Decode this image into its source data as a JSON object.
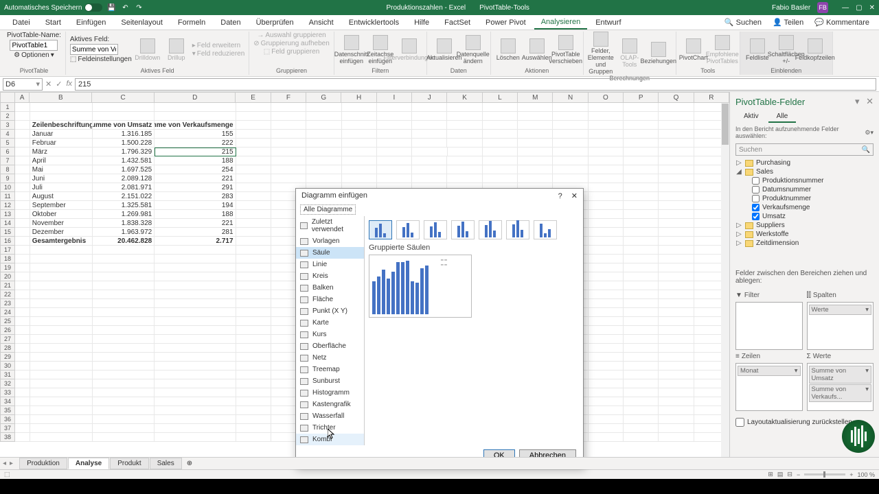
{
  "titlebar": {
    "autosave": "Automatisches Speichern",
    "doc": "Produktionszahlen",
    "app": "Excel",
    "tooltab": "PivotTable-Tools",
    "user": "Fabio Basler",
    "initials": "FB"
  },
  "tabs": [
    "Datei",
    "Start",
    "Einfügen",
    "Seitenlayout",
    "Formeln",
    "Daten",
    "Überprüfen",
    "Ansicht",
    "Entwicklertools",
    "Hilfe",
    "FactSet",
    "Power Pivot",
    "Analysieren",
    "Entwurf"
  ],
  "tab_active": "Analysieren",
  "tab_search": "Suchen",
  "tab_share": "Teilen",
  "tab_comments": "Kommentare",
  "ribbon": {
    "pivot_name_lbl": "PivotTable-Name:",
    "pivot_name": "PivotTable1",
    "options_btn": "Optionen",
    "group_pivot": "PivotTable",
    "active_field_lbl": "Aktives Feld:",
    "active_field": "Summe von Verk",
    "field_settings": "Feldeinstellungen",
    "drilldown": "Drilldown",
    "drillup": "Drillup",
    "expand_field": "Feld erweitern",
    "reduce_field": "Feld reduzieren",
    "group_active": "Aktives Feld",
    "sel_group": "Auswahl gruppieren",
    "ungroup": "Gruppierung aufheben",
    "group_field": "Feld gruppieren",
    "group_group": "Gruppieren",
    "slicer": "Datenschnitt einfügen",
    "timeline": "Zeitachse einfügen",
    "filter_conn": "Filterverbindungen",
    "group_filter": "Filtern",
    "refresh": "Aktualisieren",
    "change_src": "Datenquelle ändern",
    "group_data": "Daten",
    "delete": "Löschen",
    "select": "Auswählen",
    "move": "PivotTable verschieben",
    "group_actions": "Aktionen",
    "fields_items": "Felder, Elemente und Gruppen",
    "olap": "OLAP-Tools",
    "relations": "Beziehungen",
    "group_calc": "Berechnungen",
    "pivotchart": "PivotChart",
    "recommended": "Empfohlene PivotTables",
    "group_tools": "Tools",
    "fieldlist": "Feldliste",
    "buttons_pm": "Schaltflächen +/-",
    "headers": "Feldkopfzeilen",
    "group_show": "Einblenden"
  },
  "namebox": "D6",
  "formula": "215",
  "colheads": [
    "A",
    "B",
    "C",
    "D",
    "E",
    "F",
    "G",
    "H",
    "I",
    "J",
    "K",
    "L",
    "M",
    "N",
    "O",
    "P",
    "Q",
    "R"
  ],
  "pivot_headers": [
    "Zeilenbeschriftungen",
    "Summe von Umsatz",
    "Summe von Verkaufsmenge"
  ],
  "months": [
    "Januar",
    "Februar",
    "März",
    "April",
    "Mai",
    "Juni",
    "Juli",
    "August",
    "September",
    "Oktober",
    "November",
    "Dezember"
  ],
  "umsatz": [
    "1.316.185",
    "1.500.228",
    "1.796.329",
    "1.432.581",
    "1.697.525",
    "2.089.128",
    "2.081.971",
    "2.151.022",
    "1.325.581",
    "1.269.981",
    "1.838.328",
    "1.963.972"
  ],
  "menge": [
    "155",
    "222",
    "215",
    "188",
    "254",
    "221",
    "291",
    "283",
    "194",
    "188",
    "221",
    "281"
  ],
  "total_row": {
    "label": "Gesamtergebnis",
    "umsatz": "20.462.828",
    "menge": "2.717"
  },
  "sheets": [
    "Produktion",
    "Analyse",
    "Produkt",
    "Sales"
  ],
  "sheet_active": "Analyse",
  "dialog": {
    "title": "Diagramm einfügen",
    "tab": "Alle Diagramme",
    "categories": [
      "Zuletzt verwendet",
      "Vorlagen",
      "Säule",
      "Linie",
      "Kreis",
      "Balken",
      "Fläche",
      "Punkt (X Y)",
      "Karte",
      "Kurs",
      "Oberfläche",
      "Netz",
      "Treemap",
      "Sunburst",
      "Histogramm",
      "Kastengrafik",
      "Wasserfall",
      "Trichter",
      "Kombi"
    ],
    "cat_selected": "Säule",
    "cat_hover": "Kombi",
    "subtype_label": "Gruppierte Säulen",
    "ok": "OK",
    "cancel": "Abbrechen"
  },
  "pivotpanel": {
    "title": "PivotTable-Felder",
    "tab_active": "Aktiv",
    "tab_all": "Alle",
    "hint": "In den Bericht aufzunehmende Felder auswählen:",
    "search": "Suchen",
    "tables": [
      {
        "name": "Purchasing",
        "expanded": false
      },
      {
        "name": "Sales",
        "expanded": true,
        "fields": [
          {
            "name": "Produktionsnummer",
            "checked": false
          },
          {
            "name": "Datumsnummer",
            "checked": false
          },
          {
            "name": "Produktnummer",
            "checked": false
          },
          {
            "name": "Verkaufsmenge",
            "checked": true
          },
          {
            "name": "Umsatz",
            "checked": true
          }
        ]
      },
      {
        "name": "Suppliers",
        "expanded": false
      },
      {
        "name": "Werkstoffe",
        "expanded": false
      },
      {
        "name": "Zeitdimension",
        "expanded": false
      }
    ],
    "drag_hint": "Felder zwischen den Bereichen ziehen und ablegen:",
    "filter_lbl": "Filter",
    "cols_lbl": "Spalten",
    "rows_lbl": "Zeilen",
    "vals_lbl": "Werte",
    "cols_pill": "Werte",
    "rows_pill": "Monat",
    "vals_pills": [
      "Summe von Umsatz",
      "Summe von Verkaufs..."
    ],
    "defer": "Layoutaktualisierung zurückstellen"
  },
  "zoom": "100 %",
  "chart_data": {
    "type": "bar",
    "categories": [
      "Januar",
      "Februar",
      "März",
      "April",
      "Mai",
      "Juni",
      "Juli",
      "August",
      "September",
      "Oktober",
      "November",
      "Dezember"
    ],
    "series": [
      {
        "name": "Summe von Umsatz",
        "values": [
          1316185,
          1500228,
          1796329,
          1432581,
          1697525,
          2089128,
          2081971,
          2151022,
          1325581,
          1269981,
          1838328,
          1963972
        ]
      },
      {
        "name": "Summe von Verkaufsmenge",
        "values": [
          155,
          222,
          215,
          188,
          254,
          221,
          291,
          283,
          194,
          188,
          221,
          281
        ]
      }
    ],
    "title": "Gruppierte Säulen (Vorschau)"
  }
}
